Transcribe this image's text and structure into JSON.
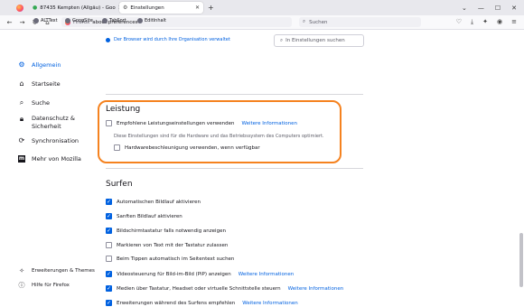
{
  "tabs": [
    {
      "title": "87435 Kempten (Allgäu) - Goo",
      "active": false
    },
    {
      "title": "Einstellungen",
      "active": true
    }
  ],
  "toolbar": {
    "url_prefix": "Firefox",
    "url": "about:preferences",
    "search_placeholder": "Suchen"
  },
  "bookmarks": [
    "ALTText",
    "GoogSite",
    "TabSort",
    "EditInhalt"
  ],
  "policy_notice": "Der Browser wird durch Ihre Organisation verwaltet",
  "prefs_search_placeholder": "In Einstellungen suchen",
  "sidebar": {
    "items": [
      {
        "label": "Allgemein",
        "icon": "gear-icon",
        "selected": true
      },
      {
        "label": "Startseite",
        "icon": "home-icon"
      },
      {
        "label": "Suche",
        "icon": "search-icon"
      },
      {
        "label": "Datenschutz &",
        "label2": "Sicherheit",
        "icon": "lock-icon"
      },
      {
        "label": "Synchronisation",
        "icon": "sync-icon"
      },
      {
        "label": "Mehr von Mozilla",
        "icon": "mozilla-icon"
      }
    ],
    "footer": [
      {
        "label": "Erweiterungen & Themes",
        "icon": "puzzle-icon"
      },
      {
        "label": "Hilfe für Firefox",
        "icon": "help-icon"
      }
    ]
  },
  "performance": {
    "heading": "Leistung",
    "recommended_label": "Empfohlene Leistungseinstellungen verwenden",
    "recommended_link": "Weitere Informationen",
    "description": "Diese Einstellungen sind für die Hardware und das Betriebssystem des Computers optimiert.",
    "hw_accel_label": "Hardwarebeschleunigung verwenden, wenn verfügbar"
  },
  "browsing": {
    "heading": "Surfen",
    "items": [
      {
        "label": "Automatischen Bildlauf aktivieren",
        "checked": true
      },
      {
        "label": "Sanften Bildlauf aktivieren",
        "checked": true
      },
      {
        "label": "Bildschirmtastatur falls notwendig anzeigen",
        "checked": true
      },
      {
        "label": "Markieren von Text mit der Tastatur zulassen",
        "checked": false
      },
      {
        "label": "Beim Tippen automatisch im Seitentext suchen",
        "checked": false
      },
      {
        "label": "Videosteuerung für Bild-im-Bild (PiP) anzeigen",
        "checked": true,
        "link": "Weitere Informationen"
      },
      {
        "label": "Medien über Tastatur, Headset oder virtuelle Schnittstelle steuern",
        "checked": true,
        "link": "Weitere Informationen"
      },
      {
        "label": "Erweiterungen während des Surfens empfehlen",
        "checked": true,
        "link": "Weitere Informationen"
      }
    ]
  }
}
